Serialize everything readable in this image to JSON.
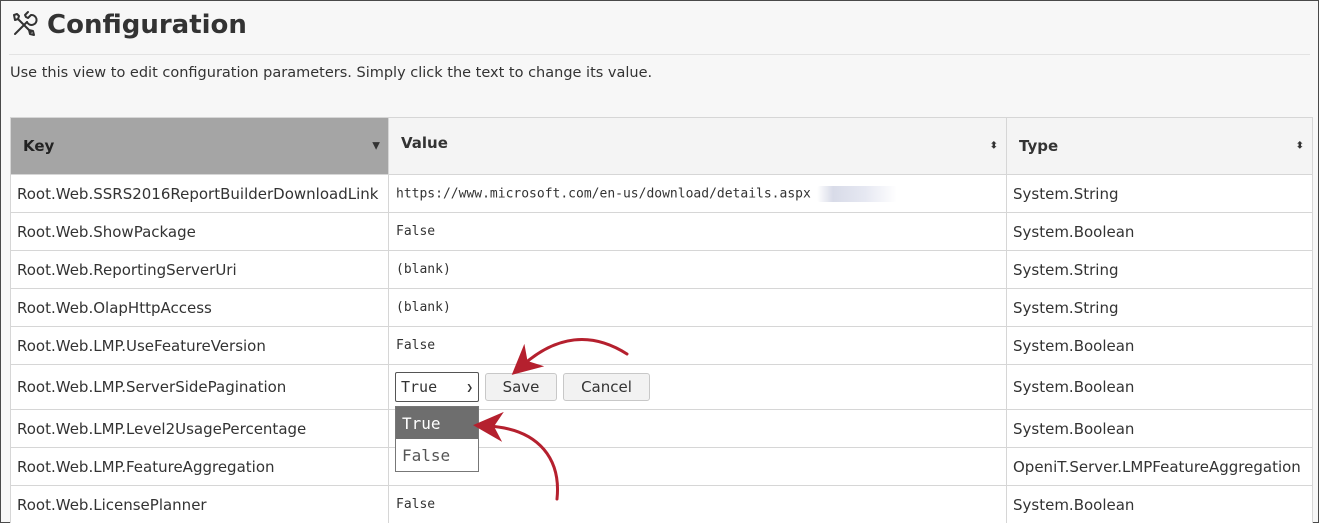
{
  "header": {
    "title": "Configuration",
    "icon": "tools-icon",
    "subtitle": "Use this view to edit configuration parameters. Simply click the text to change its value."
  },
  "table": {
    "columns": [
      {
        "label": "Key",
        "sort": "descending"
      },
      {
        "label": "Value",
        "sort": "none"
      },
      {
        "label": "Type",
        "sort": "none"
      }
    ],
    "rows": [
      {
        "key": "Root.Web.SSRS2016ReportBuilderDownloadLink",
        "value": "https://www.microsoft.com/en-us/download/details.aspx",
        "type": "System.String"
      },
      {
        "key": "Root.Web.ShowPackage",
        "value": "False",
        "type": "System.Boolean"
      },
      {
        "key": "Root.Web.ReportingServerUri",
        "value": "(blank)",
        "type": "System.String"
      },
      {
        "key": "Root.Web.OlapHttpAccess",
        "value": "(blank)",
        "type": "System.String"
      },
      {
        "key": "Root.Web.LMP.UseFeatureVersion",
        "value": "False",
        "type": "System.Boolean"
      },
      {
        "key": "Root.Web.LMP.ServerSidePagination",
        "value": "True",
        "type": "System.Boolean"
      },
      {
        "key": "Root.Web.LMP.Level2UsagePercentage",
        "value": "",
        "type": "System.Boolean"
      },
      {
        "key": "Root.Web.LMP.FeatureAggregation",
        "value": "",
        "type": "OpeniT.Server.LMPFeatureAggregation"
      },
      {
        "key": "Root.Web.LicensePlanner",
        "value": "False",
        "type": "System.Boolean"
      }
    ]
  },
  "editor": {
    "selected": "True",
    "options": [
      "True",
      "False"
    ],
    "save_label": "Save",
    "cancel_label": "Cancel"
  },
  "annotation_color": "#b5202e"
}
